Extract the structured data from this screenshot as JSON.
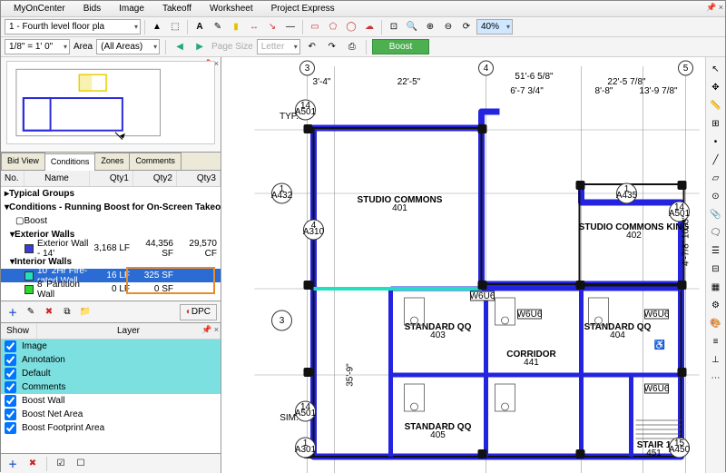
{
  "menu": [
    "MyOnCenter",
    "Bids",
    "Image",
    "Takeoff",
    "Worksheet",
    "Project Express"
  ],
  "toolbar1": {
    "scale": "1/8\" = 1' 0\"",
    "area_label": "Area",
    "area_val": "(All Areas)",
    "pagesize_label": "Page Size",
    "letter": "Letter",
    "boost": "Boost",
    "plan": "1 - Fourth level floor pla"
  },
  "zoom": "40%",
  "tabs": [
    "Bid View",
    "Conditions",
    "Zones",
    "Comments"
  ],
  "active_tab": 1,
  "cond_cols": [
    "No.",
    "Name",
    "Qty1",
    "Qty2",
    "Qty3"
  ],
  "cond": {
    "top": "Typical Groups",
    "run": "Conditions - Running Boost for On-Screen Takeoff",
    "boost_row": "Boost",
    "g1": "Exterior Walls",
    "g1a": {
      "name": "Exterior Wall - 14'",
      "q1": "3,168 LF",
      "q2": "44,356 SF",
      "q3": "29,570 CF",
      "color": "#3b3bd6"
    },
    "g2": "Interior Walls",
    "g2a": {
      "name": "10' 2Hr Fire-rated Wall",
      "q1": "16 LF",
      "q2": "325 SF",
      "q3": "",
      "color": "#21e0c0"
    },
    "g2b": {
      "name": "8' Partition Wall",
      "q1": "0 LF",
      "q2": "0 SF",
      "q3": "",
      "color": "#2fd62f"
    }
  },
  "dpc": "DPC",
  "layer_cols": [
    "Show",
    "Layer"
  ],
  "layers": [
    {
      "n": "Image",
      "hl": true
    },
    {
      "n": "Annotation",
      "hl": true
    },
    {
      "n": "Default",
      "hl": true
    },
    {
      "n": "Comments",
      "hl": true
    },
    {
      "n": "Boost Wall",
      "hl": false
    },
    {
      "n": "Boost Net Area",
      "hl": false
    },
    {
      "n": "Boost Footprint Area",
      "hl": false
    }
  ],
  "rooms": {
    "sc": "STUDIO COMMONS",
    "sc_n": "401",
    "sck": "STUDIO COMMONS KING",
    "sck_n": "402",
    "sq1": "STANDARD QQ",
    "sq1_n": "403",
    "sq2": "STANDARD QQ",
    "sq2_n": "404",
    "sq3": "STANDARD QQ",
    "sq3_n": "405",
    "cor": "CORRIDOR",
    "cor_n": "441",
    "st": "STAIR 1",
    "st_n": "451"
  },
  "dims": {
    "d1": "3'-4\"",
    "d2": "22'-5\"",
    "d3": "51'-6 5/8\"",
    "d4": "22'-5 7/8\"",
    "d5": "8'-8\"",
    "d6": "13'-9 7/8\"",
    "d7": "6'-7 3/4\"",
    "d8": "10'-3\"",
    "d9": "4'-7/8\"",
    "typ": "TYP.",
    "sim": "SIM."
  },
  "tags": {
    "a501": "A501",
    "a310": "A310",
    "a435": "A435",
    "a301": "A301",
    "a450": "A450",
    "a432": "A432",
    "n1": "1",
    "n3": "3",
    "n4": "4",
    "n5": "5",
    "n14": "14",
    "n15": "15"
  },
  "wtag": "W6U6",
  "side_h": "35'-9\""
}
